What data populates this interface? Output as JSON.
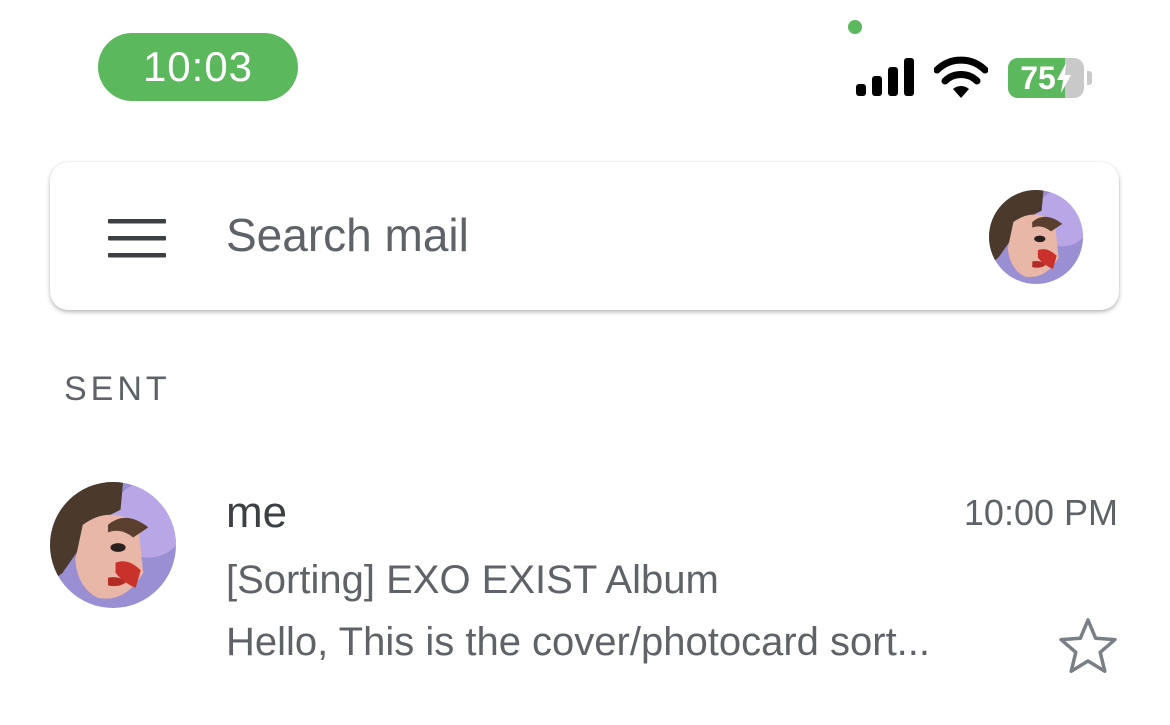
{
  "status_bar": {
    "time": "10:03",
    "battery_level": "75",
    "battery_fraction": 0.75,
    "colors": {
      "time_pill": "#5cb85c",
      "privacy_dot": "#5cb85c",
      "battery_fill": "#5cb85c",
      "icons": "#000000"
    },
    "icons": [
      "signal-icon",
      "wifi-icon",
      "battery-charging-icon"
    ]
  },
  "search": {
    "placeholder": "Search mail",
    "value": "",
    "menu_icon": "menu-icon",
    "avatar": "account-avatar"
  },
  "section": {
    "label": "SENT"
  },
  "messages": [
    {
      "sender": "me",
      "time": "10:00 PM",
      "subject": "[Sorting] EXO EXIST Album",
      "snippet": "Hello, This is the cover/photocard sort...",
      "starred": false,
      "avatar": "sender-avatar"
    }
  ]
}
